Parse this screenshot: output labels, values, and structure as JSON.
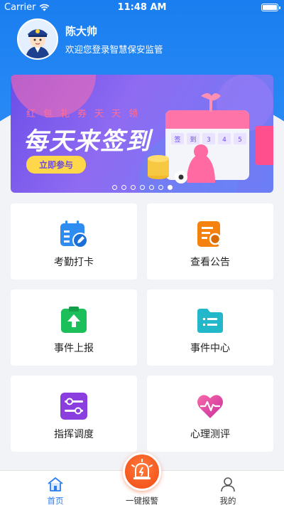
{
  "status_bar": {
    "carrier": "Carrier",
    "time": "11:48 AM"
  },
  "profile": {
    "name": "陈大帅",
    "welcome": "欢迎您登录智慧保安监管"
  },
  "banner": {
    "subtitle": "红包礼券天天领",
    "title": "每天来签到",
    "button": "立即参与",
    "calendar_cells": [
      "签",
      "到",
      "3",
      "4",
      "5"
    ],
    "page_count": 7,
    "active_page": 7
  },
  "menu": [
    {
      "label": "考勤打卡",
      "icon": "calendar-edit-icon",
      "color": "#2f8cf0"
    },
    {
      "label": "查看公告",
      "icon": "document-search-icon",
      "color": "#f5820f"
    },
    {
      "label": "事件上报",
      "icon": "upload-clipboard-icon",
      "color": "#1dbf5a"
    },
    {
      "label": "事件中心",
      "icon": "folder-list-icon",
      "color": "#22b8c9"
    },
    {
      "label": "指挥调度",
      "icon": "sliders-icon",
      "color": "#8a3ee0"
    },
    {
      "label": "心理测评",
      "icon": "heart-pulse-icon",
      "color": "#f0448c"
    }
  ],
  "tabbar": {
    "home": "首页",
    "alarm": "一键报警",
    "mine": "我的"
  }
}
